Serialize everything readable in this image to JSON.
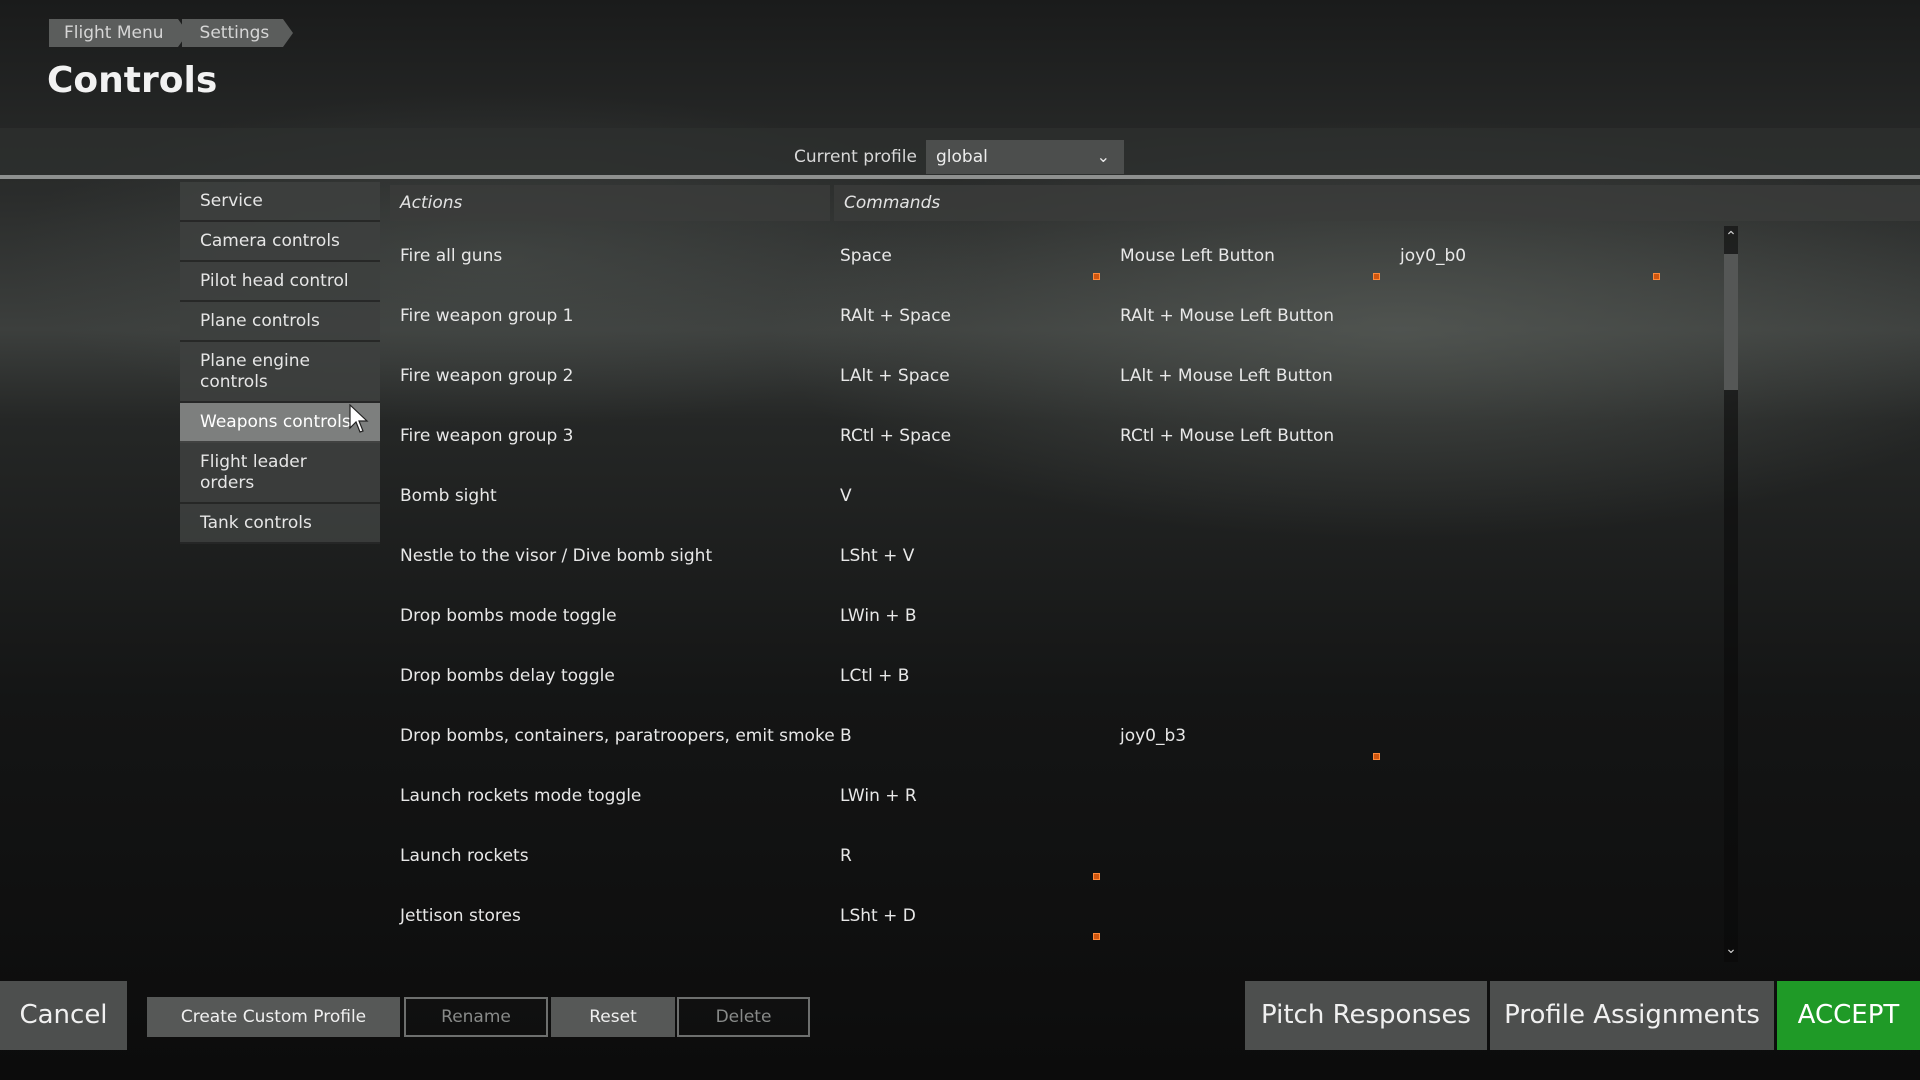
{
  "breadcrumb": [
    "Flight Menu",
    "Settings"
  ],
  "title": "Controls",
  "profile": {
    "label": "Current profile",
    "value": "global"
  },
  "sidebar": {
    "items": [
      "Service",
      "Camera controls",
      "Pilot head control",
      "Plane controls",
      "Plane engine controls",
      "Weapons controls",
      "Flight leader orders",
      "Tank controls"
    ],
    "active_index": 5
  },
  "table": {
    "headers": {
      "actions": "Actions",
      "commands": "Commands"
    },
    "rows": [
      {
        "action": "Fire all guns",
        "keys": [
          "Space",
          "Mouse Left Button",
          "joy0_b0"
        ]
      },
      {
        "action": "Fire weapon group 1",
        "keys": [
          "RAlt + Space",
          "RAlt + Mouse Left Button",
          ""
        ]
      },
      {
        "action": "Fire weapon group 2",
        "keys": [
          "LAlt + Space",
          "LAlt + Mouse Left Button",
          ""
        ]
      },
      {
        "action": "Fire weapon group 3",
        "keys": [
          "RCtl + Space",
          "RCtl + Mouse Left Button",
          ""
        ]
      },
      {
        "action": "Bomb sight",
        "keys": [
          "V",
          "",
          ""
        ]
      },
      {
        "action": "Nestle to the visor / Dive bomb sight",
        "keys": [
          "LSht + V",
          "",
          ""
        ]
      },
      {
        "action": "Drop bombs mode toggle",
        "keys": [
          "LWin + B",
          "",
          ""
        ]
      },
      {
        "action": "Drop bombs delay toggle",
        "keys": [
          "LCtl + B",
          "",
          ""
        ]
      },
      {
        "action": "Drop bombs, containers, paratroopers, emit smoke",
        "keys": [
          "B",
          "joy0_b3",
          ""
        ]
      },
      {
        "action": "Launch rockets mode toggle",
        "keys": [
          "LWin + R",
          "",
          ""
        ]
      },
      {
        "action": "Launch rockets",
        "keys": [
          "R",
          "",
          ""
        ]
      },
      {
        "action": "Jettison stores",
        "keys": [
          "LSht + D",
          "",
          ""
        ]
      }
    ]
  },
  "buttons": {
    "cancel": "Cancel",
    "create_profile": "Create Custom Profile",
    "rename": "Rename",
    "reset": "Reset",
    "delete": "Delete",
    "pitch": "Pitch Responses",
    "profile_assign": "Profile Assignments",
    "accept": "ACCEPT"
  },
  "colors": {
    "accent": "#1f9a27",
    "marker": "#d0560f"
  },
  "icons": {
    "cursor": "cursor-arrow-icon",
    "dropdown": "chevron-down-icon",
    "scroll_up": "arrow-up-icon",
    "scroll_down": "arrow-down-icon"
  }
}
